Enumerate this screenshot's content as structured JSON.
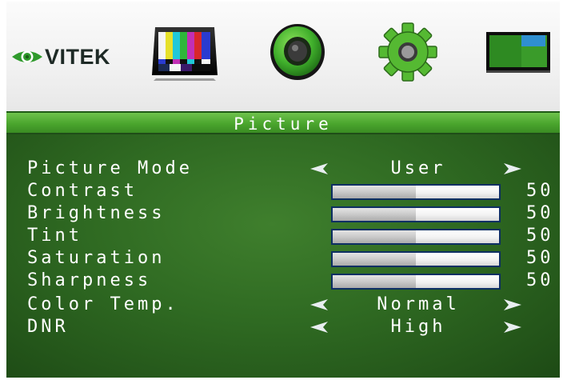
{
  "brand": {
    "name": "VITEK"
  },
  "top_menu": [
    {
      "icon": "color-bars-icon"
    },
    {
      "icon": "speaker-icon"
    },
    {
      "icon": "gear-icon"
    },
    {
      "icon": "screen-icon"
    }
  ],
  "menu": {
    "title": "Picture",
    "items": [
      {
        "label": "Picture Mode",
        "type": "option",
        "value": "User"
      },
      {
        "label": "Contrast",
        "type": "slider",
        "value": 50,
        "display": "50"
      },
      {
        "label": "Brightness",
        "type": "slider",
        "value": 50,
        "display": "50"
      },
      {
        "label": "Tint",
        "type": "slider",
        "value": 50,
        "display": "50"
      },
      {
        "label": "Saturation",
        "type": "slider",
        "value": 50,
        "display": "50"
      },
      {
        "label": "Sharpness",
        "type": "slider",
        "value": 50,
        "display": "50"
      },
      {
        "label": "Color Temp.",
        "type": "option",
        "value": "Normal"
      },
      {
        "label": "DNR",
        "type": "option",
        "value": "High"
      }
    ]
  },
  "colors": {
    "panel_green": "#2f6a22",
    "title_green": "#4aa52d",
    "slider_frame": "#0e2f63",
    "text": "#ffffff"
  }
}
